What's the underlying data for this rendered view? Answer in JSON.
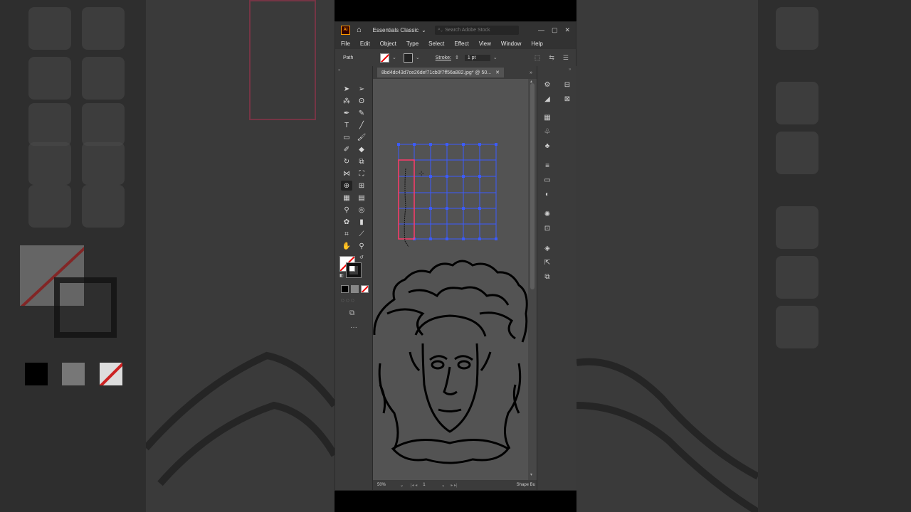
{
  "titlebar": {
    "app_logo": "Ai",
    "workspace": "Essentials Classic",
    "search_placeholder": "Search Adobe Stock"
  },
  "menu": [
    "File",
    "Edit",
    "Object",
    "Type",
    "Select",
    "Effect",
    "View",
    "Window",
    "Help"
  ],
  "control": {
    "selection_type": "Path",
    "stroke_label": "Stroke:",
    "stroke_value": "1 pt"
  },
  "document": {
    "tab_title": "8bd4dc43d7ce26def71cb0f7ff56a882.jpg* @ 50...",
    "zoom": "50%",
    "artboard": "1",
    "status_tool": "Shape Bu"
  },
  "toolbox_icons": [
    "selection-tool",
    "direct-selection-tool",
    "magic-wand-tool",
    "lasso-tool",
    "pen-tool",
    "curvature-tool",
    "type-tool",
    "line-segment-tool",
    "rectangle-tool",
    "paintbrush-tool",
    "shaper-tool",
    "eraser-tool",
    "rotate-tool",
    "scale-tool",
    "width-tool",
    "free-transform-tool",
    "shape-builder-tool",
    "perspective-grid-tool",
    "mesh-tool",
    "gradient-tool",
    "eyedropper-tool",
    "blend-tool",
    "symbol-sprayer-tool",
    "column-graph-tool",
    "artboard-tool",
    "slice-tool",
    "hand-tool",
    "zoom-tool"
  ],
  "colors": {
    "grid_line": "#3b5bff",
    "selection_outline": "#ff3b6b",
    "art_stroke": "#000000"
  }
}
